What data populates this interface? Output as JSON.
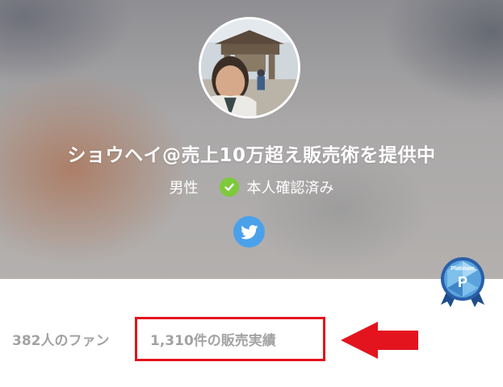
{
  "profile": {
    "name": "ショウヘイ@売上10万超え販売術を提供中",
    "gender": "男性",
    "verified_label": "本人確認済み",
    "badge_text": "Platinum",
    "badge_letter": "P"
  },
  "stats": {
    "fans": "382人のファン",
    "sales": "1,310件の販売実績"
  },
  "colors": {
    "verified": "#7ec93c",
    "twitter": "#4aa1ea",
    "highlight": "#e3141e",
    "stat_text": "#a3a3a3"
  },
  "icons": {
    "social": "twitter-icon",
    "verified": "check-icon",
    "badge": "platinum-badge-icon",
    "annotation": "red-arrow-icon"
  }
}
